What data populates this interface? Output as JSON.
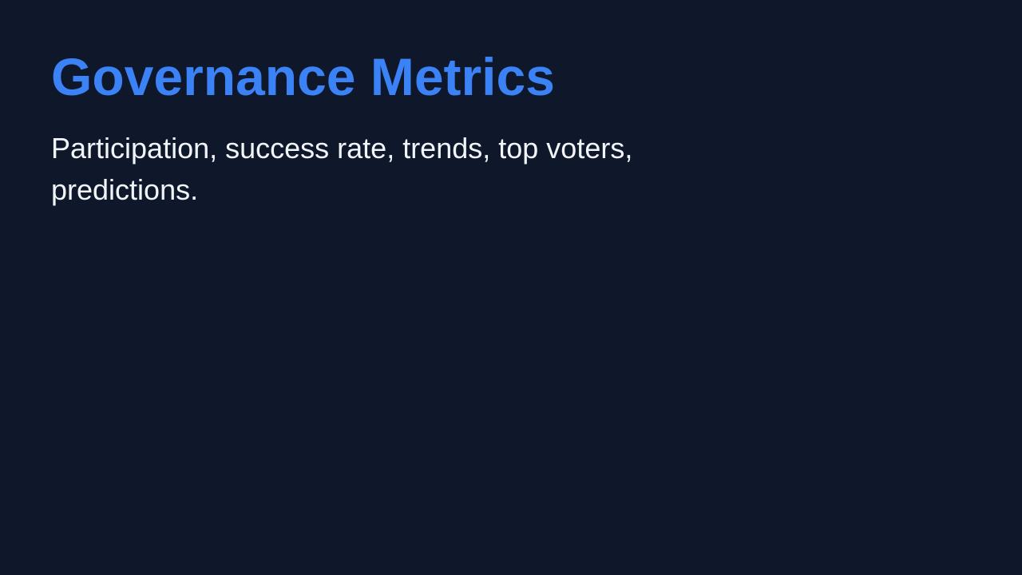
{
  "slide": {
    "title": "Governance Metrics",
    "subtitle": "Participation, success rate, trends, top voters, predictions."
  },
  "colors": {
    "background": "#0f172a",
    "title": "#3b82f6",
    "subtitle": "#f1f5f9"
  }
}
